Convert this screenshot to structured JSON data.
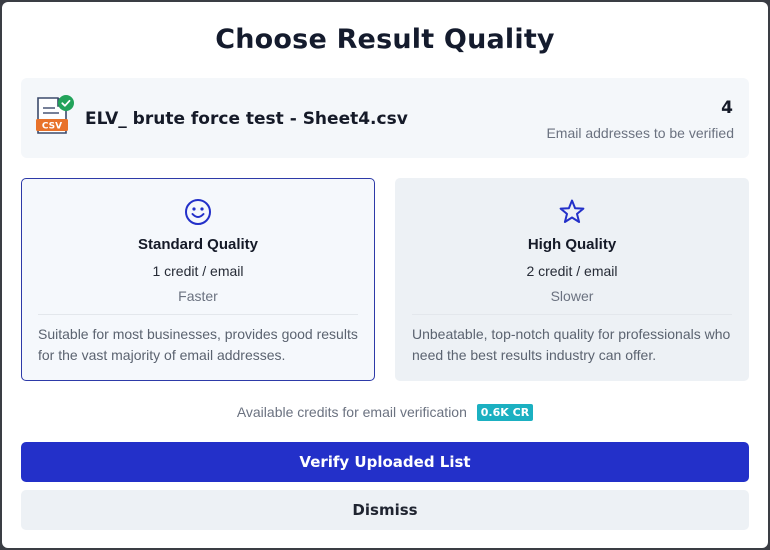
{
  "modal": {
    "title": "Choose Result Quality"
  },
  "file": {
    "icon": "csv-file-icon",
    "icon_badge": "check-circle-icon",
    "icon_label": "CSV",
    "name": "ELV_ brute force test - Sheet4.csv",
    "count": "4",
    "count_label": "Email addresses to be verified"
  },
  "options": [
    {
      "icon": "smiley-icon",
      "title": "Standard Quality",
      "credit": "1 credit / email",
      "speed": "Faster",
      "description": "Suitable for most businesses, provides good results for the vast majority of email addresses.",
      "selected": true
    },
    {
      "icon": "star-icon",
      "title": "High Quality",
      "credit": "2 credit / email",
      "speed": "Slower",
      "description": "Unbeatable, top-notch quality for professionals who need the best results industry can offer.",
      "selected": false
    }
  ],
  "credits": {
    "label": "Available credits for email verification",
    "badge": "0.6K CR"
  },
  "actions": {
    "verify_label": "Verify Uploaded List",
    "dismiss_label": "Dismiss"
  },
  "colors": {
    "primary": "#2330c9",
    "badge": "#1bb0c1",
    "success": "#22a35a",
    "csv_orange": "#e8722a"
  }
}
